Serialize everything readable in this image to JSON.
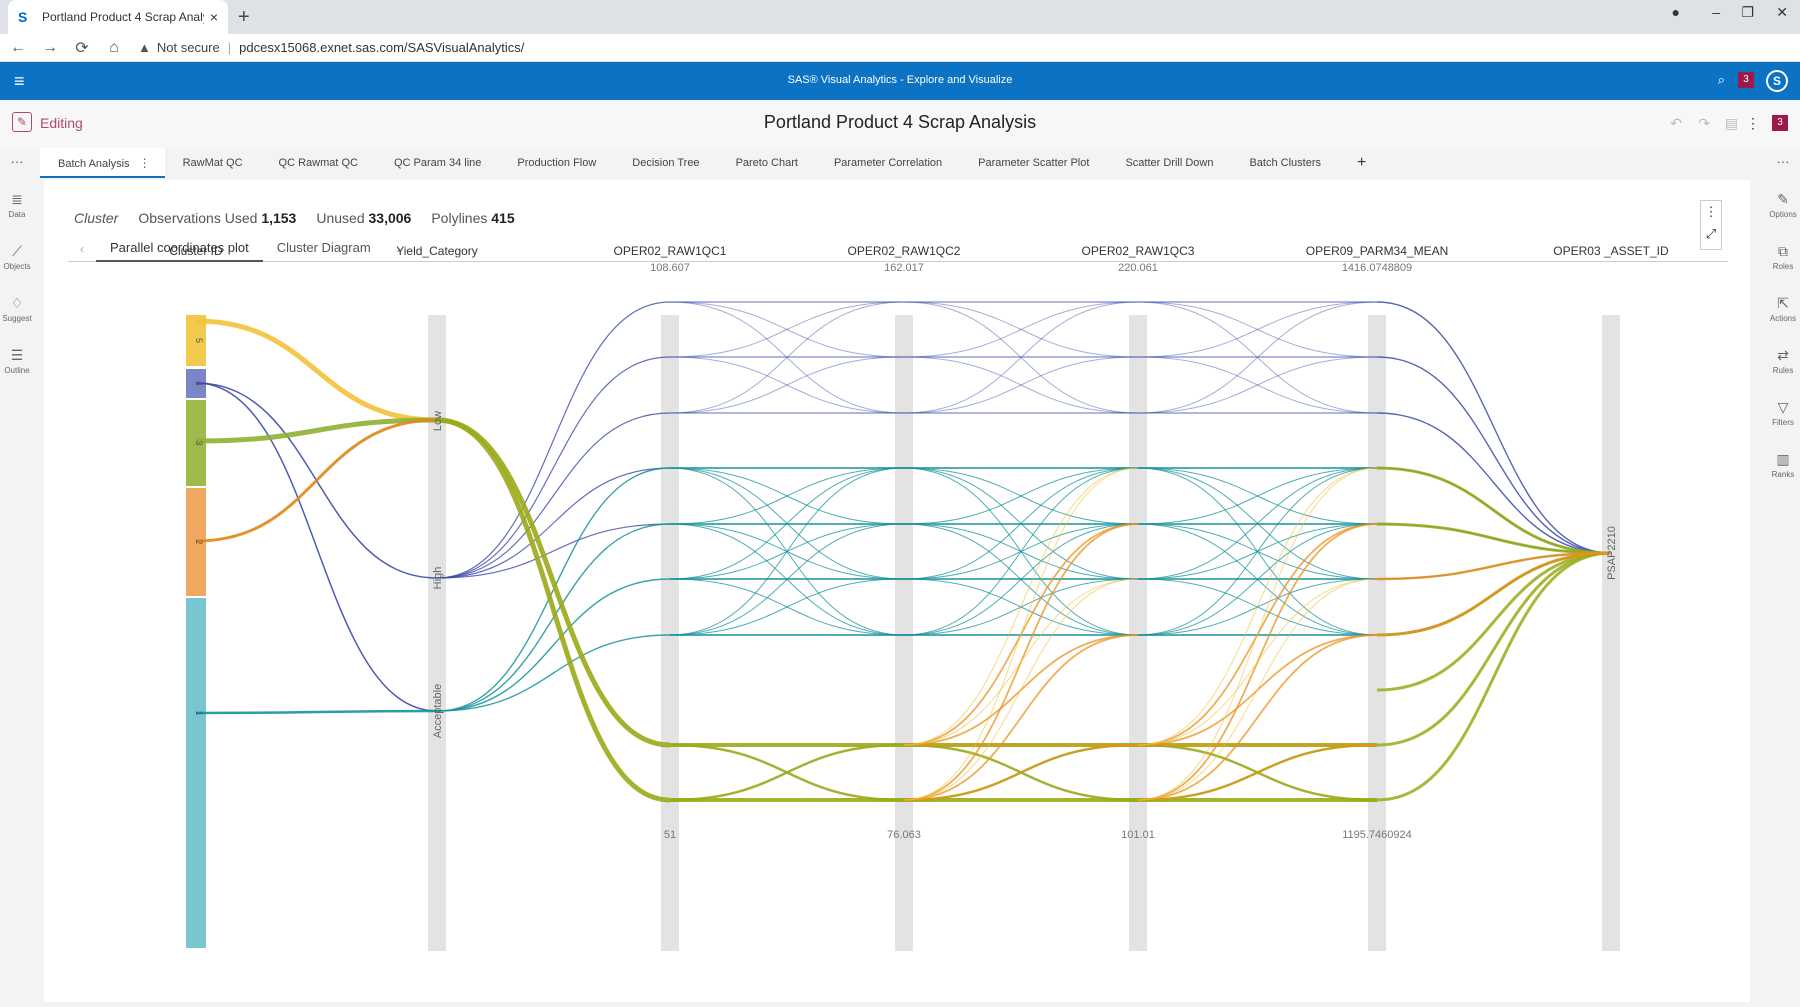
{
  "browser": {
    "tab_title": "Portland Product 4 Scrap Analysis",
    "url_warning": "Not secure",
    "url": "pdcesx15068.exnet.sas.com/SASVisualAnalytics/"
  },
  "sas": {
    "app_title": "SAS® Visual Analytics - Explore and Visualize",
    "notif_count": "3",
    "logo_letter": "S"
  },
  "report": {
    "mode": "Editing",
    "title": "Portland Product 4 Scrap Analysis",
    "badge": "3"
  },
  "tabs": [
    "Batch Analysis",
    "RawMat QC",
    "QC Rawmat QC",
    "QC Param 34 line",
    "Production Flow",
    "Decision Tree",
    "Pareto Chart",
    "Parameter Correlation",
    "Parameter Scatter Plot",
    "Scatter Drill Down",
    "Batch Clusters"
  ],
  "left_rail": [
    "Data",
    "Objects",
    "Suggest",
    "Outline"
  ],
  "right_rail": [
    "Options",
    "Roles",
    "Actions",
    "Rules",
    "Filters",
    "Ranks"
  ],
  "info": {
    "cluster": "Cluster",
    "obs_label": "Observations Used",
    "obs_value": "1,153",
    "unused_label": "Unused",
    "unused_value": "33,006",
    "poly_label": "Polylines",
    "poly_value": "415"
  },
  "subtabs": [
    "Parallel coordinates plot",
    "Cluster Diagram"
  ],
  "chart_data": {
    "type": "parallel_coordinates",
    "axes": [
      {
        "name": "Cluster ID",
        "categories": [
          "5",
          "4",
          "3",
          "2",
          "1"
        ]
      },
      {
        "name": "Yield_Category",
        "categories": [
          "Low",
          "High",
          "Acceptable"
        ]
      },
      {
        "name": "OPER02_RAW1QC1",
        "max": "108.607",
        "min": "51"
      },
      {
        "name": "OPER02_RAW1QC2",
        "max": "162.017",
        "min": "76.063"
      },
      {
        "name": "OPER02_RAW1QC3",
        "max": "220.061",
        "min": "101.01"
      },
      {
        "name": "OPER09_PARM34_MEAN",
        "max": "1416.0748809",
        "min": "1195.7460924"
      },
      {
        "name": "OPER03 _ASSET_ID",
        "categories": [
          "PSAP2210"
        ]
      }
    ],
    "clusters": [
      {
        "id": "5",
        "color": "#f2c94c"
      },
      {
        "id": "4",
        "color": "#7b86c9"
      },
      {
        "id": "3",
        "color": "#9cbb4a"
      },
      {
        "id": "2",
        "color": "#f0a860"
      },
      {
        "id": "1",
        "color": "#7ac6d0"
      }
    ],
    "line_colors": {
      "high": "#3a4aa8",
      "acceptable": "#16929a",
      "low": "#9aaa18",
      "orange": "#e9911e"
    }
  }
}
